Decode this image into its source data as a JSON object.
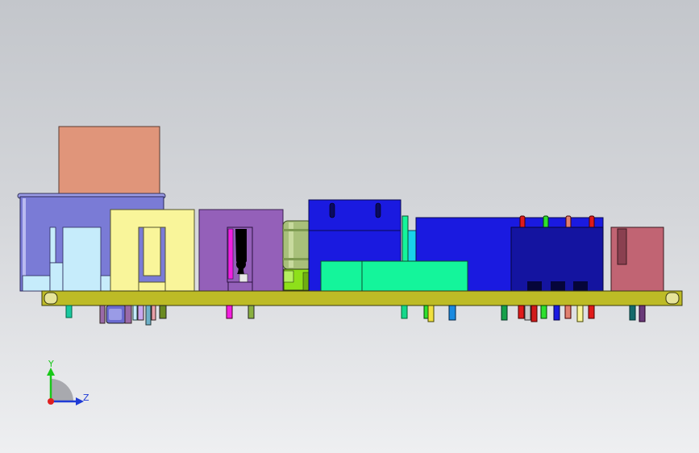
{
  "viewport": {
    "background_top": "#c3c6cb",
    "background_bottom": "#eeeff1"
  },
  "model": {
    "pcb_color": "#bdbb26",
    "colors": {
      "salmon": "#e0957a",
      "purple_blue": "#7a7bd6",
      "light_cyan": "#c6ecfb",
      "yellow": "#f9f59a",
      "violet": "#9460b9",
      "magenta": "#f21ee0",
      "olive_green": "#a8c07a",
      "lime": "#8ee01a",
      "blue": "#1a1ae0",
      "cyan": "#19d2ea",
      "spring_green": "#14f59b",
      "navy": "#1414a0",
      "rose": "#c16473"
    }
  },
  "triad": {
    "y_label": "Y",
    "z_label": "Z",
    "y_color": "#19c819",
    "z_color": "#1f3bd6",
    "x_color": "#e02020"
  }
}
